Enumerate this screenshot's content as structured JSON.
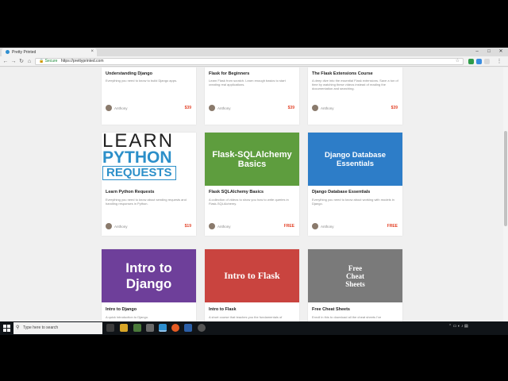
{
  "browser": {
    "tab_title": "Pretty Printed",
    "tab_close": "×",
    "window_controls": [
      "–",
      "□",
      "✕"
    ],
    "nav": {
      "back": "←",
      "forward": "→",
      "reload": "↻",
      "home": "⌂"
    },
    "address": {
      "secure_label": "Secure",
      "url": "https://prettyprinted.com"
    },
    "star": "☆",
    "menu": "⋮"
  },
  "courses": [
    {
      "title": "Understanding Django",
      "desc": "Everything you need to know to build Django apps.",
      "author": "Anthony",
      "price": "$39"
    },
    {
      "title": "Flask for Beginners",
      "desc": "Learn Flask from scratch. Learn enough basics to start creating real applications.",
      "author": "Anthony",
      "price": "$39"
    },
    {
      "title": "The Flask Extensions Course",
      "desc": "A deep dive into the essential Flask extensions. Save a ton of time by watching these videos instead of reading the documentation and searching.",
      "author": "Anthony",
      "price": "$39"
    },
    {
      "image_lines": [
        "LEARN",
        "PYTHON",
        "REQUESTS"
      ],
      "title": "Learn Python Requests",
      "desc": "Everything you need to know about sending requests and handling responses in Python.",
      "author": "Anthony",
      "price": "$19",
      "image_bg": "#ffffff"
    },
    {
      "image_text": "Flask-SQLAlchemy Basics",
      "title": "Flask SQLAlchemy Basics",
      "desc": "A collection of videos to show you how to write queries in Flask-SQLAlchemy.",
      "author": "Anthony",
      "price": "FREE",
      "image_bg": "#5e9d3e"
    },
    {
      "image_text": "Django Database Essentials",
      "title": "Django Database Essentials",
      "desc": "Everything you need to know about working with models in Django.",
      "author": "Anthony",
      "price": "FREE",
      "image_bg": "#2d7dc8"
    },
    {
      "image_text": "Intro to Django",
      "title": "Intro to Django",
      "desc": "A quick introduction to Django.",
      "image_bg": "#6e3f9a"
    },
    {
      "image_text": "Intro to Flask",
      "title": "Intro to Flask",
      "desc": "A short course that teaches you the fundamentals of",
      "image_bg": "#c9443f"
    },
    {
      "image_lines": [
        "Free",
        "Cheat",
        "Sheets"
      ],
      "title": "Free Cheat Sheets",
      "desc": "Enroll in this to download all the cheat sheets I've",
      "image_bg": "#7a7a7a"
    }
  ],
  "taskbar": {
    "search_placeholder": "Type here to search",
    "clock_time": "",
    "clock_date": ""
  },
  "colors": {
    "price": "#e3452b",
    "taskbar": "#101418"
  }
}
